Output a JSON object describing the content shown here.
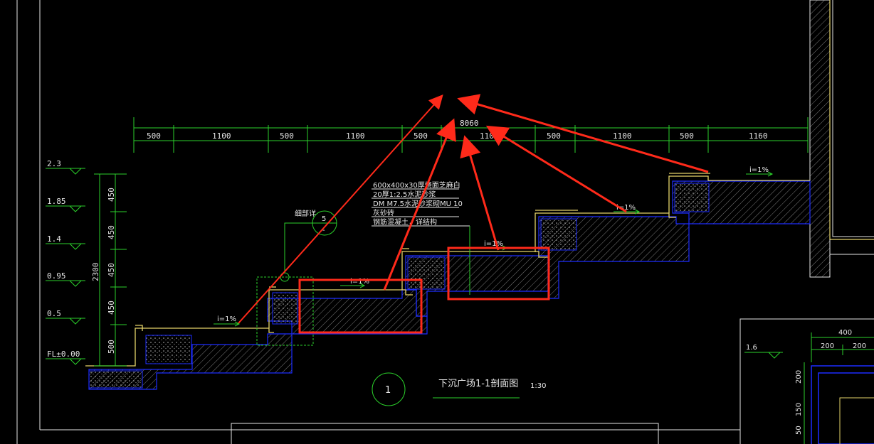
{
  "drawing": {
    "top_dimension": {
      "total": "8060",
      "segments": [
        "500",
        "1100",
        "500",
        "1100",
        "500",
        "1100",
        "500",
        "1100",
        "500",
        "1160"
      ]
    },
    "elevations": [
      "2.3",
      "1.85",
      "1.4",
      "0.95",
      "0.5",
      "FL±0.00"
    ],
    "vertical_total": "2300",
    "vertical_segments": [
      "450",
      "450",
      "450",
      "450",
      "500"
    ],
    "slope_labels": [
      "i=1%",
      "i=1%",
      "i=1%",
      "i=1%",
      "i=1%"
    ],
    "callout_lines": [
      "600x400x30厚烧面芝麻白",
      "20厚1:2.5水泥砂浆",
      "DM M7.5水泥砂浆砌MU 10",
      "灰砂砖",
      "钢筋混凝土，详结构"
    ],
    "detail_note": "细部详",
    "detail_bubble": {
      "top": "5",
      "bottom": "-"
    },
    "section_number": "1",
    "section_title": "下沉广场1-1剖面图",
    "section_scale": "1:30",
    "right_detail": {
      "elevation": "1.6",
      "top_dim": "400",
      "sub_dims": [
        "200",
        "200"
      ],
      "vert_dims": [
        "200",
        "150",
        "50"
      ]
    },
    "colors": {
      "background": "#000000",
      "dimension": "#2bd12b",
      "structure": "#1c2cff",
      "finish": "#e5d46a",
      "annotation": "#ff2a1a",
      "text": "#e6e6e6",
      "hatch": "#8a8a8a"
    }
  }
}
